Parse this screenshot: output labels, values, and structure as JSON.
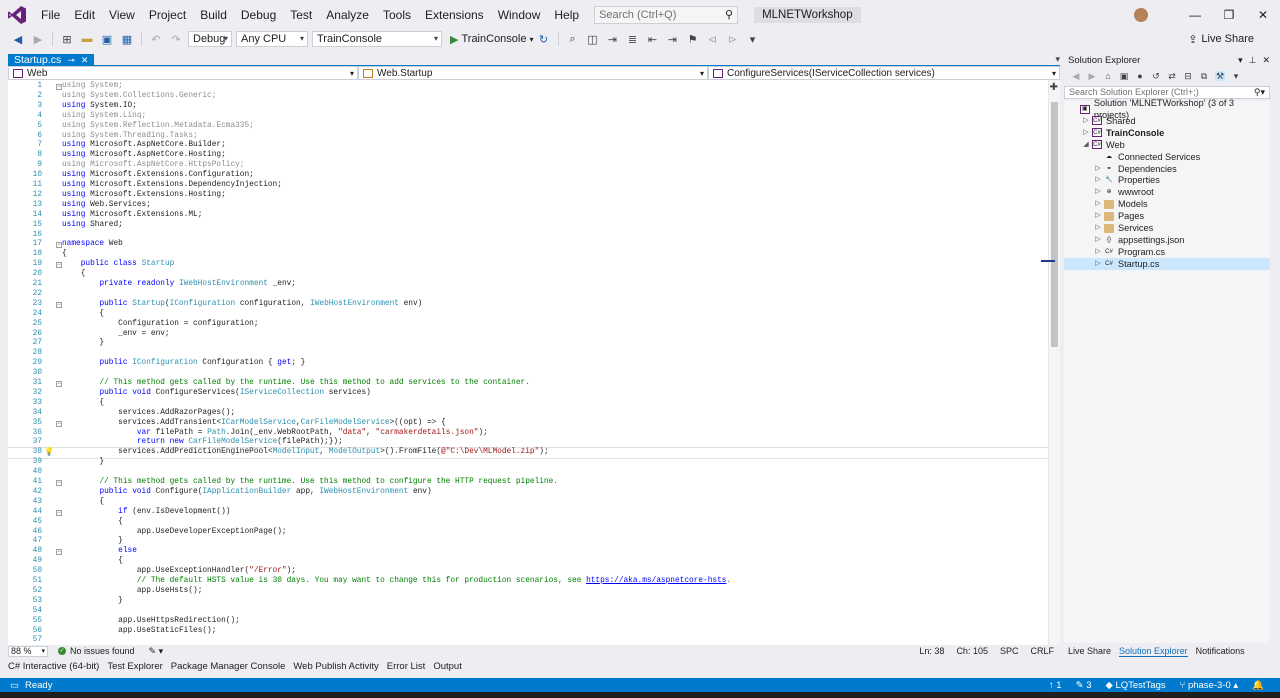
{
  "menubar": {
    "items": [
      "File",
      "Edit",
      "View",
      "Project",
      "Build",
      "Debug",
      "Test",
      "Analyze",
      "Tools",
      "Extensions",
      "Window",
      "Help"
    ],
    "search_placeholder": "Search (Ctrl+Q)",
    "solution_name": "MLNETWorkshop"
  },
  "toolbar": {
    "config": "Debug",
    "platform": "Any CPU",
    "startup_project": "TrainConsole",
    "run_label": "TrainConsole",
    "live_share": "Live Share"
  },
  "editor_tab": {
    "label": "Startup.cs"
  },
  "navbar": {
    "project": "Web",
    "class": "Web.Startup",
    "member": "ConfigureServices(IServiceCollection services)"
  },
  "code_lines": [
    {
      "n": "1",
      "fold": "−",
      "html": "<span class=\"d\">using System;</span>"
    },
    {
      "n": "2",
      "html": "<span class=\"d\">using System.Collections.Generic;</span>"
    },
    {
      "n": "3",
      "html": "<span class=\"k\">using</span> System.IO;"
    },
    {
      "n": "4",
      "html": "<span class=\"d\">using System.Linq;</span>"
    },
    {
      "n": "5",
      "html": "<span class=\"d\">using System.Reflection.Metadata.Ecma335;</span>"
    },
    {
      "n": "6",
      "html": "<span class=\"d\">using System.Threading.Tasks;</span>"
    },
    {
      "n": "7",
      "html": "<span class=\"k\">using</span> Microsoft.AspNetCore.Builder;"
    },
    {
      "n": "8",
      "html": "<span class=\"k\">using</span> Microsoft.AspNetCore.Hosting;"
    },
    {
      "n": "9",
      "html": "<span class=\"d\">using Microsoft.AspNetCore.HttpsPolicy;</span>"
    },
    {
      "n": "10",
      "html": "<span class=\"k\">using</span> Microsoft.Extensions.Configuration;"
    },
    {
      "n": "11",
      "html": "<span class=\"k\">using</span> Microsoft.Extensions.DependencyInjection;"
    },
    {
      "n": "12",
      "html": "<span class=\"k\">using</span> Microsoft.Extensions.Hosting;"
    },
    {
      "n": "13",
      "html": "<span class=\"k\">using</span> Web.Services;"
    },
    {
      "n": "14",
      "html": "<span class=\"k\">using</span> Microsoft.Extensions.ML;"
    },
    {
      "n": "15",
      "html": "<span class=\"k\">using</span> Shared;"
    },
    {
      "n": "16",
      "html": ""
    },
    {
      "n": "17",
      "fold": "−",
      "html": "<span class=\"k\">namespace</span> Web"
    },
    {
      "n": "18",
      "html": "{"
    },
    {
      "n": "19",
      "fold": "−",
      "html": "    <span class=\"k\">public class</span> <span class=\"t\">Startup</span>"
    },
    {
      "n": "20",
      "html": "    {"
    },
    {
      "n": "21",
      "html": "        <span class=\"k\">private readonly</span> <span class=\"t\">IWebHostEnvironment</span> _env;"
    },
    {
      "n": "22",
      "html": ""
    },
    {
      "n": "23",
      "fold": "−",
      "html": "        <span class=\"k\">public</span> <span class=\"t\">Startup</span>(<span class=\"t\">IConfiguration</span> configuration, <span class=\"t\">IWebHostEnvironment</span> env)"
    },
    {
      "n": "24",
      "html": "        {"
    },
    {
      "n": "25",
      "html": "            Configuration = configuration;"
    },
    {
      "n": "26",
      "html": "            _env = env;"
    },
    {
      "n": "27",
      "html": "        }"
    },
    {
      "n": "28",
      "html": ""
    },
    {
      "n": "29",
      "html": "        <span class=\"k\">public</span> <span class=\"t\">IConfiguration</span> Configuration { <span class=\"k\">get</span>; }"
    },
    {
      "n": "30",
      "html": ""
    },
    {
      "n": "31",
      "fold": "−",
      "html": "        <span class=\"c\">// This method gets called by the runtime. Use this method to add services to the container.</span>"
    },
    {
      "n": "32",
      "html": "        <span class=\"k\">public void</span> ConfigureServices(<span class=\"t\">IServiceCollection</span> services)"
    },
    {
      "n": "33",
      "html": "        {"
    },
    {
      "n": "34",
      "html": "            services.AddRazorPages();"
    },
    {
      "n": "35",
      "fold": "−",
      "html": "            services.AddTransient&lt;<span class=\"t\">ICarModelService</span>,<span class=\"t\">CarFileModelService</span>&gt;((opt) =&gt; {"
    },
    {
      "n": "36",
      "html": "                <span class=\"k\">var</span> filePath = <span class=\"t\">Path</span>.Join(_env.WebRootPath, <span class=\"s\">\"data\"</span>, <span class=\"s\">\"carmakerdetails.json\"</span>);"
    },
    {
      "n": "37",
      "html": "                <span class=\"k\">return new</span> <span class=\"t\">CarFileModelService</span>(filePath);});"
    },
    {
      "n": "38",
      "bulb": true,
      "cur": true,
      "html": "            services.AddPredictionEnginePool&lt;<span class=\"t\">ModelInput</span>, <span class=\"t\">ModelOutput</span>&gt;().FromFile(<span class=\"s\">@\"C:\\Dev\\MLModel.zip\"</span>);"
    },
    {
      "n": "39",
      "html": "        }"
    },
    {
      "n": "40",
      "html": ""
    },
    {
      "n": "41",
      "fold": "−",
      "html": "        <span class=\"c\">// This method gets called by the runtime. Use this method to configure the HTTP request pipeline.</span>"
    },
    {
      "n": "42",
      "html": "        <span class=\"k\">public void</span> Configure(<span class=\"t\">IApplicationBuilder</span> app, <span class=\"t\">IWebHostEnvironment</span> env)"
    },
    {
      "n": "43",
      "html": "        {"
    },
    {
      "n": "44",
      "fold": "−",
      "html": "            <span class=\"k\">if</span> (env.IsDevelopment())"
    },
    {
      "n": "45",
      "html": "            {"
    },
    {
      "n": "46",
      "html": "                app.UseDeveloperExceptionPage();"
    },
    {
      "n": "47",
      "html": "            }"
    },
    {
      "n": "48",
      "fold": "−",
      "html": "            <span class=\"k\">else</span>"
    },
    {
      "n": "49",
      "html": "            {"
    },
    {
      "n": "50",
      "html": "                app.UseExceptionHandler(<span class=\"s\">\"/Error\"</span>);"
    },
    {
      "n": "51",
      "html": "                <span class=\"c\">// The default HSTS value is 30 days. You may want to change this for production scenarios, see </span><span class=\"u\">https://aka.ms/aspnetcore-hsts</span><span class=\"c\">.</span>"
    },
    {
      "n": "52",
      "html": "                app.UseHsts();"
    },
    {
      "n": "53",
      "html": "            }"
    },
    {
      "n": "54",
      "html": ""
    },
    {
      "n": "55",
      "html": "            app.UseHttpsRedirection();"
    },
    {
      "n": "56",
      "html": "            app.UseStaticFiles();"
    },
    {
      "n": "57",
      "html": ""
    }
  ],
  "editor_status": {
    "zoom": "88 %",
    "issues": "No issues found",
    "line": "Ln: 38",
    "col": "Ch: 105",
    "spc": "SPC",
    "crlf": "CRLF"
  },
  "bottom_tabs": [
    "C# Interactive (64-bit)",
    "Test Explorer",
    "Package Manager Console",
    "Web Publish Activity",
    "Error List",
    "Output"
  ],
  "statusbar": {
    "ready": "Ready",
    "up_count": "1",
    "edits": "3",
    "repo": "LQTestTags",
    "branch": "phase-3-0"
  },
  "solution_explorer": {
    "title": "Solution Explorer",
    "search_placeholder": "Search Solution Explorer (Ctrl+;)",
    "items": [
      {
        "label": "Solution 'MLNETWorkshop' (3 of 3 projects)",
        "indent": 0,
        "exp": "",
        "icon": "sol"
      },
      {
        "label": "Shared",
        "indent": 1,
        "exp": "▷",
        "icon": "proj"
      },
      {
        "label": "TrainConsole",
        "indent": 1,
        "exp": "▷",
        "icon": "proj",
        "bold": true
      },
      {
        "label": "Web",
        "indent": 1,
        "exp": "◢",
        "icon": "proj"
      },
      {
        "label": "Connected Services",
        "indent": 2,
        "exp": "",
        "icon": "conn"
      },
      {
        "label": "Dependencies",
        "indent": 2,
        "exp": "▷",
        "icon": "dep"
      },
      {
        "label": "Properties",
        "indent": 2,
        "exp": "▷",
        "icon": "prop"
      },
      {
        "label": "wwwroot",
        "indent": 2,
        "exp": "▷",
        "icon": "globe"
      },
      {
        "label": "Models",
        "indent": 2,
        "exp": "▷",
        "icon": "folder"
      },
      {
        "label": "Pages",
        "indent": 2,
        "exp": "▷",
        "icon": "folder"
      },
      {
        "label": "Services",
        "indent": 2,
        "exp": "▷",
        "icon": "folder"
      },
      {
        "label": "appsettings.json",
        "indent": 2,
        "exp": "▷",
        "icon": "json"
      },
      {
        "label": "Program.cs",
        "indent": 2,
        "exp": "▷",
        "icon": "cs"
      },
      {
        "label": "Startup.cs",
        "indent": 2,
        "exp": "▷",
        "icon": "cs",
        "selected": true
      }
    ],
    "tabs": [
      "Live Share",
      "Solution Explorer",
      "Notifications"
    ]
  }
}
